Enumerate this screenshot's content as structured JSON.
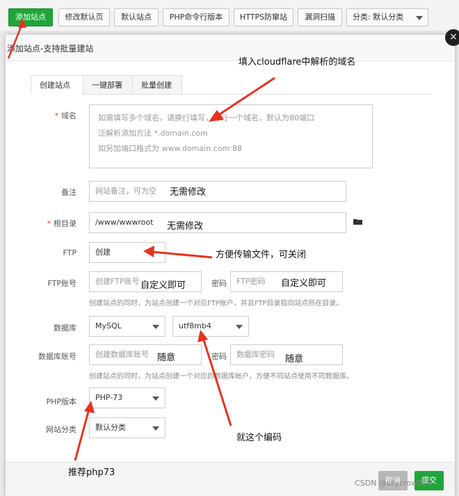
{
  "toolbar": {
    "add_site": "添加站点",
    "edit_default_page": "修改默认页",
    "default_site": "默认站点",
    "php_cli_version": "PHP命令行版本",
    "https_protect": "HTTPS防窜站",
    "vuln_scan": "漏洞扫描",
    "category_select": "分类: 默认分类"
  },
  "dialog": {
    "title": "添加站点-支持批量建站",
    "close": "×",
    "tabs": [
      "创建站点",
      "一键部署",
      "批量创建"
    ],
    "domain": {
      "label": "域名",
      "placeholder_lines": [
        "如需填写多个域名，请换行填写，每行一个域名，默认为80端口",
        "泛解析添加方法 *.domain.com",
        "如另加端口格式为 www.domain.com:88"
      ]
    },
    "remark": {
      "label": "备注",
      "placeholder": "网站备注，可为空"
    },
    "root": {
      "label": "根目录",
      "value": "/www/wwwroot"
    },
    "ftp": {
      "label": "FTP",
      "value": "创建"
    },
    "ftp_account": {
      "label": "FTP账号",
      "placeholder": "创建FTP账号",
      "password_label": "密码",
      "password_placeholder": "FTP密码",
      "hint": "创建站点的同时，为站点创建一个对应FTP帐户，并且FTP目录指向站点所在目录。"
    },
    "database": {
      "label": "数据库",
      "value": "MySQL",
      "charset": "utf8mb4"
    },
    "db_account": {
      "label": "数据库账号",
      "placeholder": "创建数据库账号",
      "password_label": "密码",
      "password_placeholder": "数据库密码",
      "hint": "创建站点的同时，为站点创建一个对应的数据库帐户，方便不同站点使用不同数据库。"
    },
    "php": {
      "label": "PHP版本",
      "value": "PHP-73"
    },
    "site_category": {
      "label": "网站分类",
      "value": "默认分类"
    },
    "footer": {
      "cancel": "取消",
      "submit": "提交"
    }
  },
  "annotations": {
    "domain_note": "填入cloudflare中解析的域名",
    "remark_note": "无需修改",
    "root_note": "无需修改",
    "ftp_note": "方便传输文件，可关闭",
    "ftp_user_note": "自定义即可",
    "ftp_pass_note": "自定义即可",
    "db_user_note": "随意",
    "db_pass_note": "随意",
    "charset_note": "就这个编码",
    "php_note": "推荐php73"
  },
  "watermark": "CSDN @skycrow520",
  "colors": {
    "primary": "#20a53a",
    "required": "#e33333",
    "annotation_arrow": "#e8321e"
  }
}
